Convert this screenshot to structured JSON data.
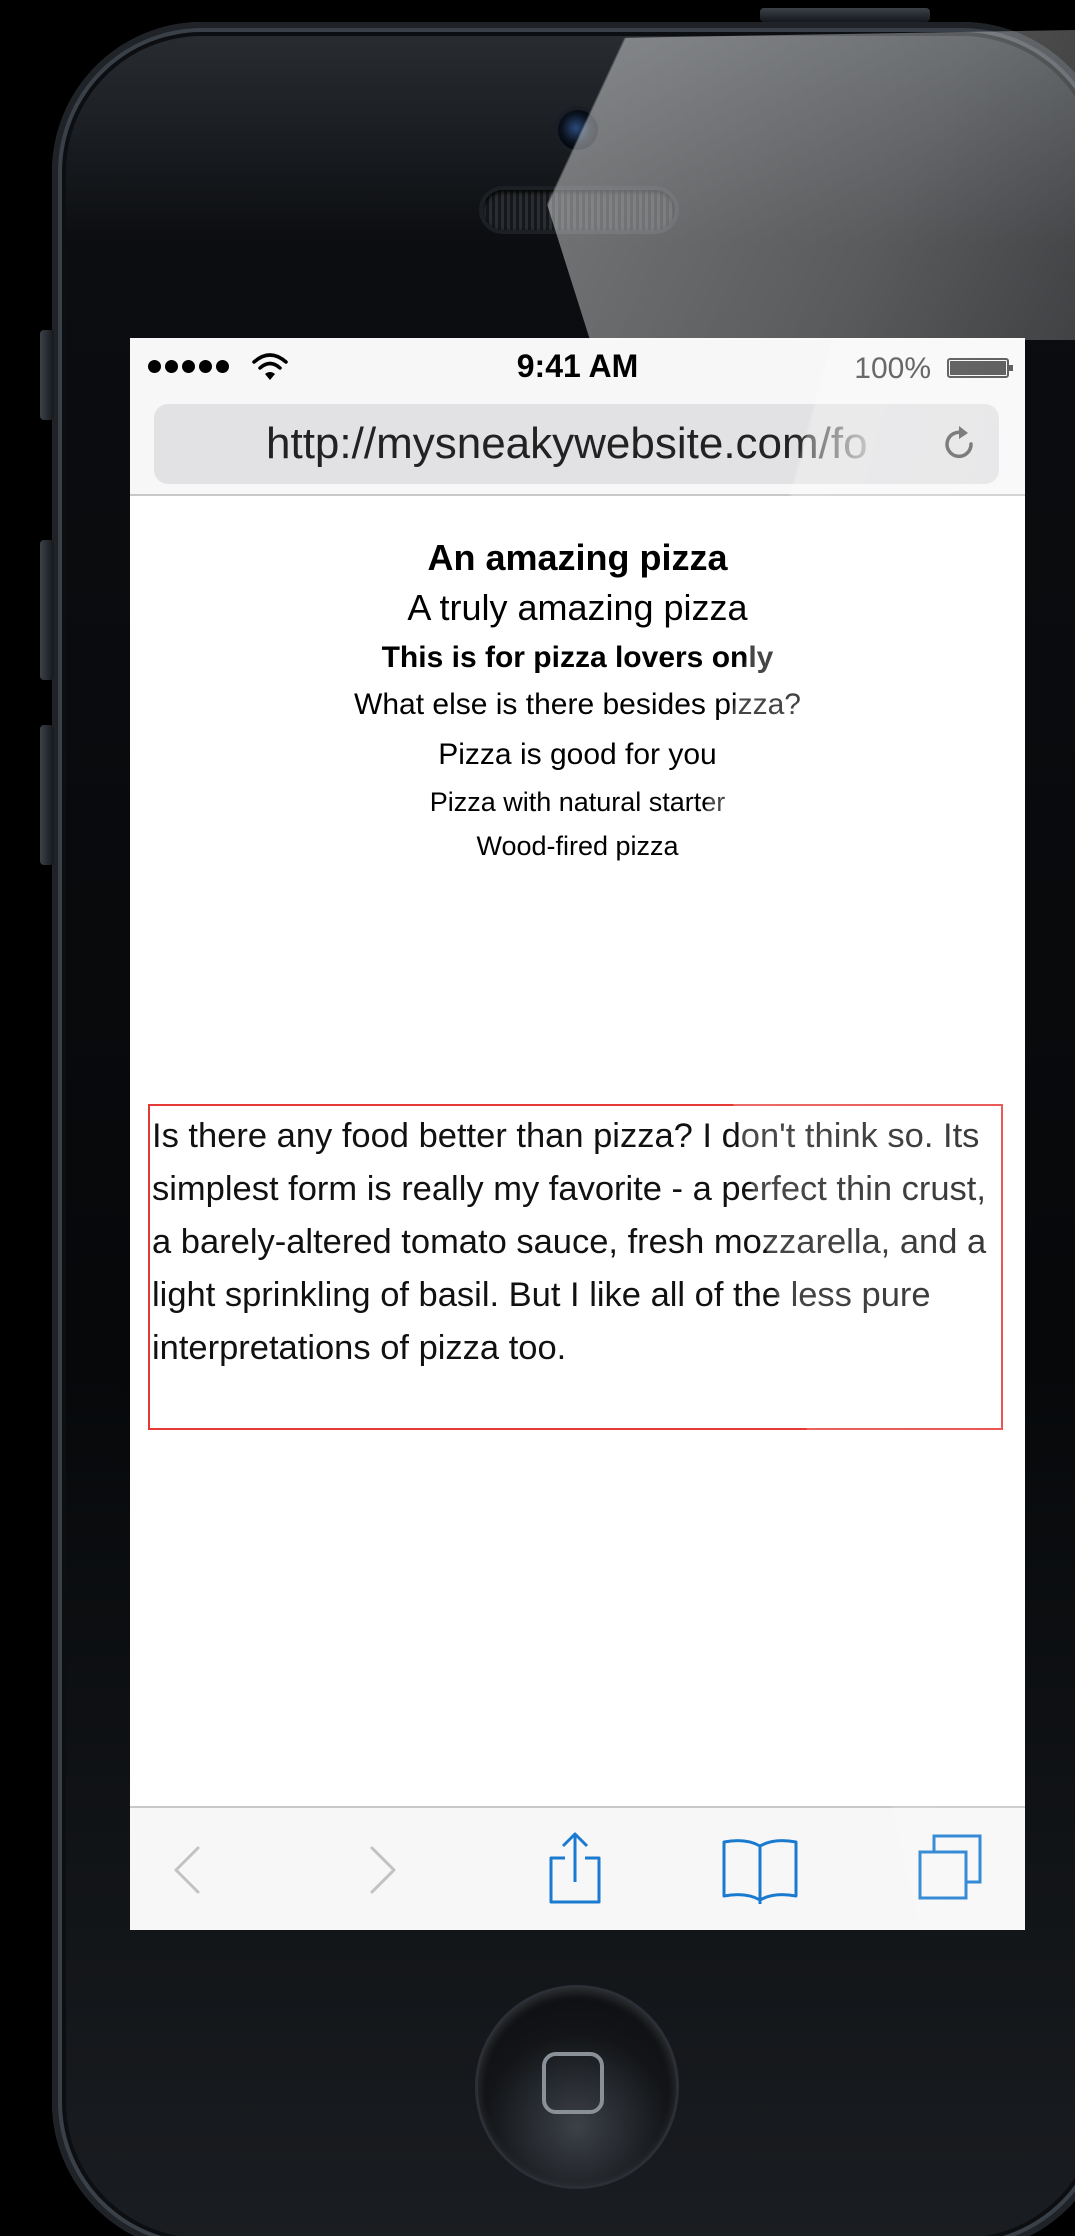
{
  "status_bar": {
    "time": "9:41 AM",
    "battery": "100%"
  },
  "browser": {
    "url": "http://mysneakywebsite.com/fo"
  },
  "page": {
    "headings": [
      "An amazing pizza",
      "A truly amazing pizza",
      "This is for pizza lovers only",
      "What else is there besides pizza?",
      "Pizza is good for you",
      "Pizza with natural starter",
      "Wood-fired pizza"
    ],
    "paragraph": "Is there any food better than pizza? I don't think so. Its simplest form is really my favorite - a perfect thin crust, a barely-altered tomato sauce, fresh mozzarella, and a light sprinkling of basil. But I like all of the less pure interpretations of pizza too."
  },
  "toolbar": {
    "icons": [
      "back-icon",
      "forward-icon",
      "share-icon",
      "bookmarks-icon",
      "tabs-icon"
    ]
  },
  "colors": {
    "highlight_border": "#e53935",
    "ios_blue": "#1a7ad0",
    "disabled_gray": "#c2c2c2"
  }
}
